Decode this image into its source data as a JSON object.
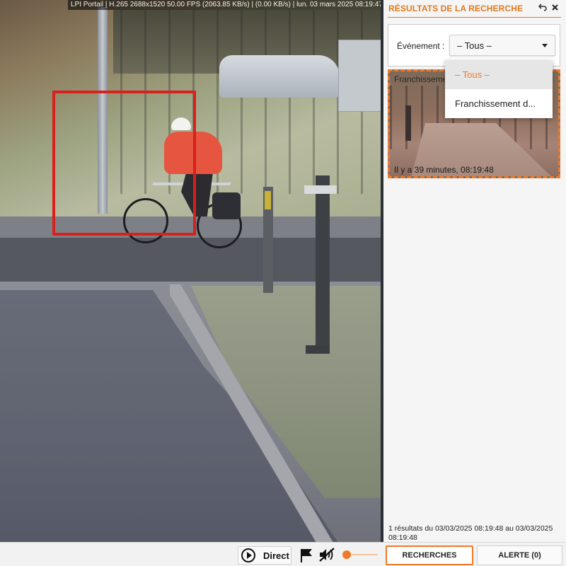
{
  "video": {
    "osd_text": "LPI Portail | H.265 2688x1520 50.00 FPS (2063.85 KB/s) | (0.00 KB/s) | lun. 03 mars 2025 08:19:47"
  },
  "panel": {
    "title": "RÉSULTATS DE LA RECHERCHE",
    "icons": [
      "undo-icon",
      "close-icon"
    ],
    "filter": {
      "label": "Événement :",
      "selected": "– Tous –",
      "options": [
        "– Tous –",
        "Franchissement d..."
      ]
    },
    "result": {
      "title": "Franchissement",
      "time": "Il y a 39 minutes, 08:19:48"
    },
    "summary": "1 résultats du 03/03/2025 08:19:48 au 03/03/2025 08:19:48"
  },
  "toolbar": {
    "direct_label": "Direct",
    "search_label": "RECHERCHES",
    "alert_label": "ALERTE (0)",
    "volume_level": 0
  },
  "colors": {
    "accent": "#f07a28",
    "detection_box": "#d8201c"
  }
}
